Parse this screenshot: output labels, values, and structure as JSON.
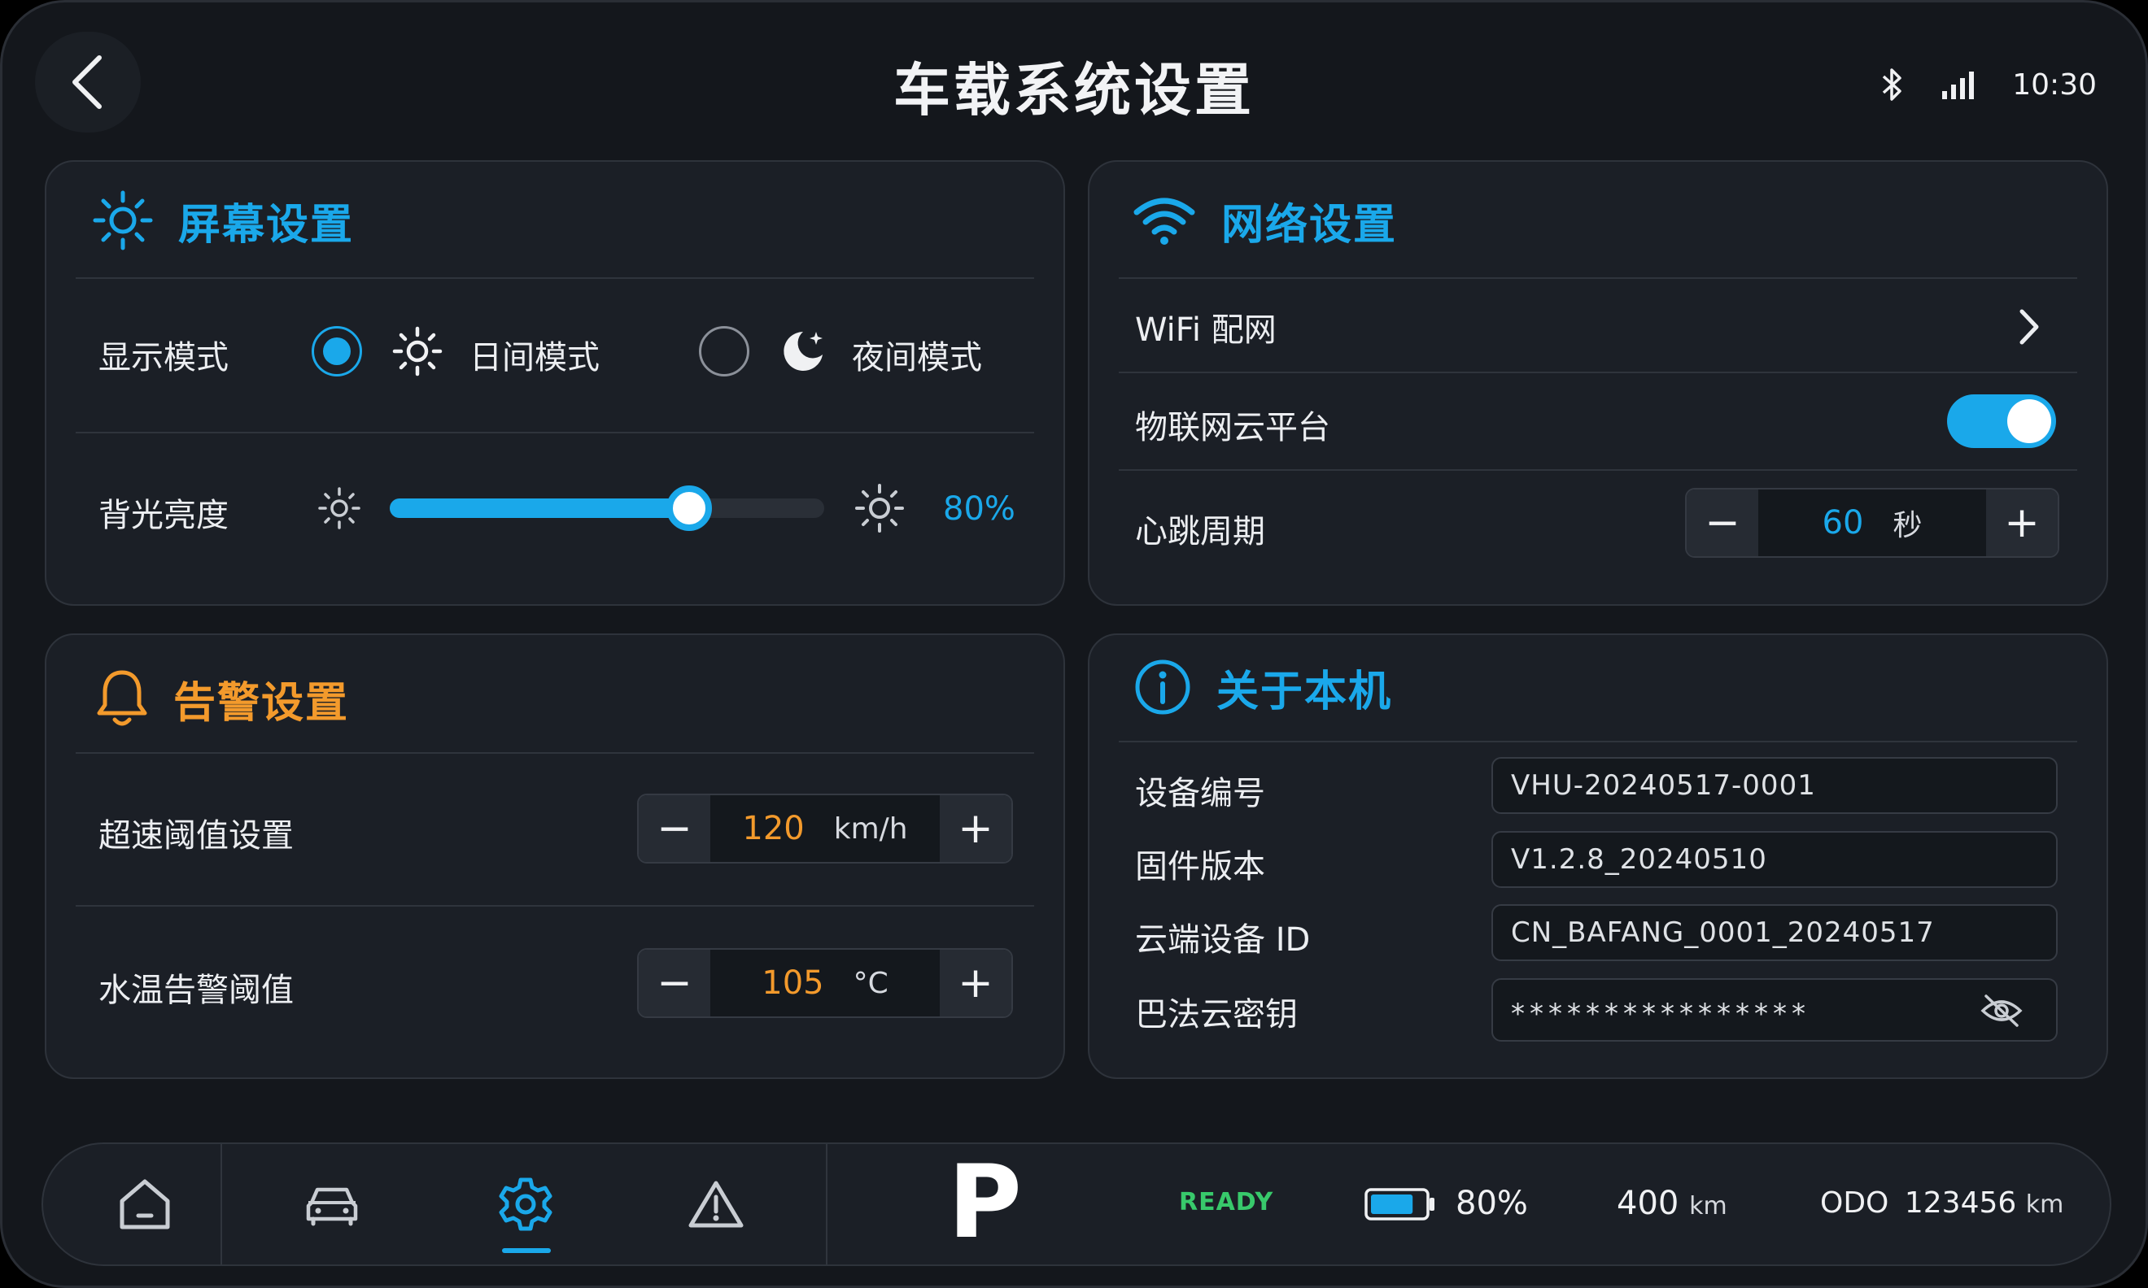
{
  "header": {
    "title": "车载系统设置",
    "time": "10:30"
  },
  "screen_settings": {
    "title": "屏幕设置",
    "display_mode": {
      "label": "显示模式",
      "options": [
        "日间模式",
        "夜间模式"
      ],
      "selected": "日间模式"
    },
    "backlight": {
      "label": "背光亮度",
      "value_text": "80%",
      "level": 0.69
    }
  },
  "network_settings": {
    "title": "网络设置",
    "wifi_label": "WiFi 配网",
    "iot_label": "物联网云平台",
    "iot_enabled": true,
    "heartbeat": {
      "label": "心跳周期",
      "value": "60",
      "unit": "秒"
    }
  },
  "alarm_settings": {
    "title": "告警设置",
    "overspeed": {
      "label": "超速阈值设置",
      "value": "120",
      "unit": "km/h"
    },
    "water_temp": {
      "label": "水温告警阈值",
      "value": "105",
      "unit": "°C"
    }
  },
  "about": {
    "title": "关于本机",
    "fields": [
      {
        "label": "设备编号",
        "value": "VHU-20240517-0001"
      },
      {
        "label": "固件版本",
        "value": "V1.2.8_20240510"
      },
      {
        "label": "云端设备 ID",
        "value": "CN_BAFANG_0001_20240517"
      },
      {
        "label": "巴法云密钥",
        "value": "****************"
      }
    ]
  },
  "bottom_bar": {
    "nav": [
      "home-icon",
      "car-icon",
      "settings-icon",
      "warning-icon"
    ],
    "active_nav": "settings-icon",
    "gear": "P",
    "ready": "READY",
    "battery_text": "80%",
    "battery_level": 0.8,
    "range_value": "400",
    "range_unit": "km",
    "odo_label": "ODO",
    "odo_value": "123456",
    "odo_unit": "km"
  },
  "colors": {
    "accent_blue": "#1aa8ea",
    "accent_orange": "#f39a2c",
    "ready_green": "#38c96b",
    "card_bg": "#1b1f26",
    "screen_bg": "#14171c"
  }
}
